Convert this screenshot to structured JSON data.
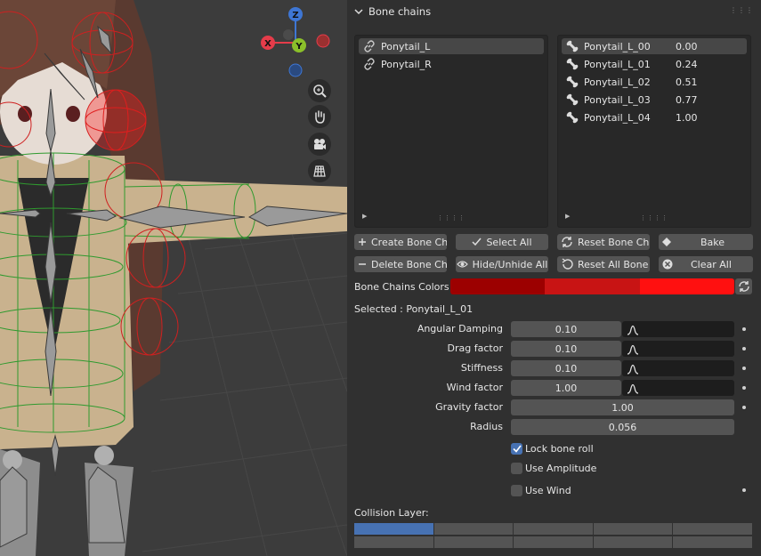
{
  "panel": {
    "title": "Bone chains",
    "chains": [
      {
        "name": "Ponytail_L",
        "selected": true
      },
      {
        "name": "Ponytail_R",
        "selected": false
      }
    ],
    "bones": [
      {
        "name": "Ponytail_L_00",
        "value": "0.00",
        "selected": true
      },
      {
        "name": "Ponytail_L_01",
        "value": "0.24",
        "selected": false
      },
      {
        "name": "Ponytail_L_02",
        "value": "0.51",
        "selected": false
      },
      {
        "name": "Ponytail_L_03",
        "value": "0.77",
        "selected": false
      },
      {
        "name": "Ponytail_L_04",
        "value": "1.00",
        "selected": false
      }
    ],
    "buttons": {
      "create": "Create Bone Ch...",
      "select_all": "Select All",
      "reset_chain": "Reset Bone Ch...",
      "bake": "Bake",
      "delete": "Delete Bone Ch...",
      "hide_unhide": "Hide/Unhide All",
      "reset_all": "Reset All Bone ...",
      "clear_all": "Clear All"
    },
    "colors_label": "Bone Chains Colors",
    "chain_colors": [
      "#9c0000",
      "#c81414",
      "#ff1010"
    ],
    "selected_label": "Selected : Ponytail_L_01",
    "properties": [
      {
        "label": "Angular Damping",
        "value": "0.10",
        "curve": true,
        "dot": true
      },
      {
        "label": "Drag factor",
        "value": "0.10",
        "curve": true,
        "dot": true
      },
      {
        "label": "Stiffness",
        "value": "0.10",
        "curve": true,
        "dot": true
      },
      {
        "label": "Wind factor",
        "value": "1.00",
        "curve": true,
        "dot": true
      },
      {
        "label": "Gravity factor",
        "value": "1.00",
        "curve": false,
        "dot": true
      },
      {
        "label": "Radius",
        "value": "0.056",
        "curve": false,
        "dot": false
      }
    ],
    "checkboxes": [
      {
        "label": "Lock bone roll",
        "checked": true
      },
      {
        "label": "Use Amplitude",
        "checked": false
      },
      {
        "label": "Use Wind",
        "checked": false
      }
    ],
    "collision_label": "Collision Layer:",
    "collision_layers": {
      "rows": 2,
      "cols": 5,
      "active": [
        0
      ]
    }
  },
  "viewport": {
    "gizmo": {
      "z": "Z",
      "x": "X",
      "y": "Y"
    },
    "tools": [
      "zoom-icon",
      "hand-pan-icon",
      "camera-icon",
      "grid-icon"
    ],
    "colors": {
      "x": "#e53c4a",
      "y": "#8bc02a",
      "z": "#3e76d4",
      "bg": "#3c3c3c"
    }
  }
}
